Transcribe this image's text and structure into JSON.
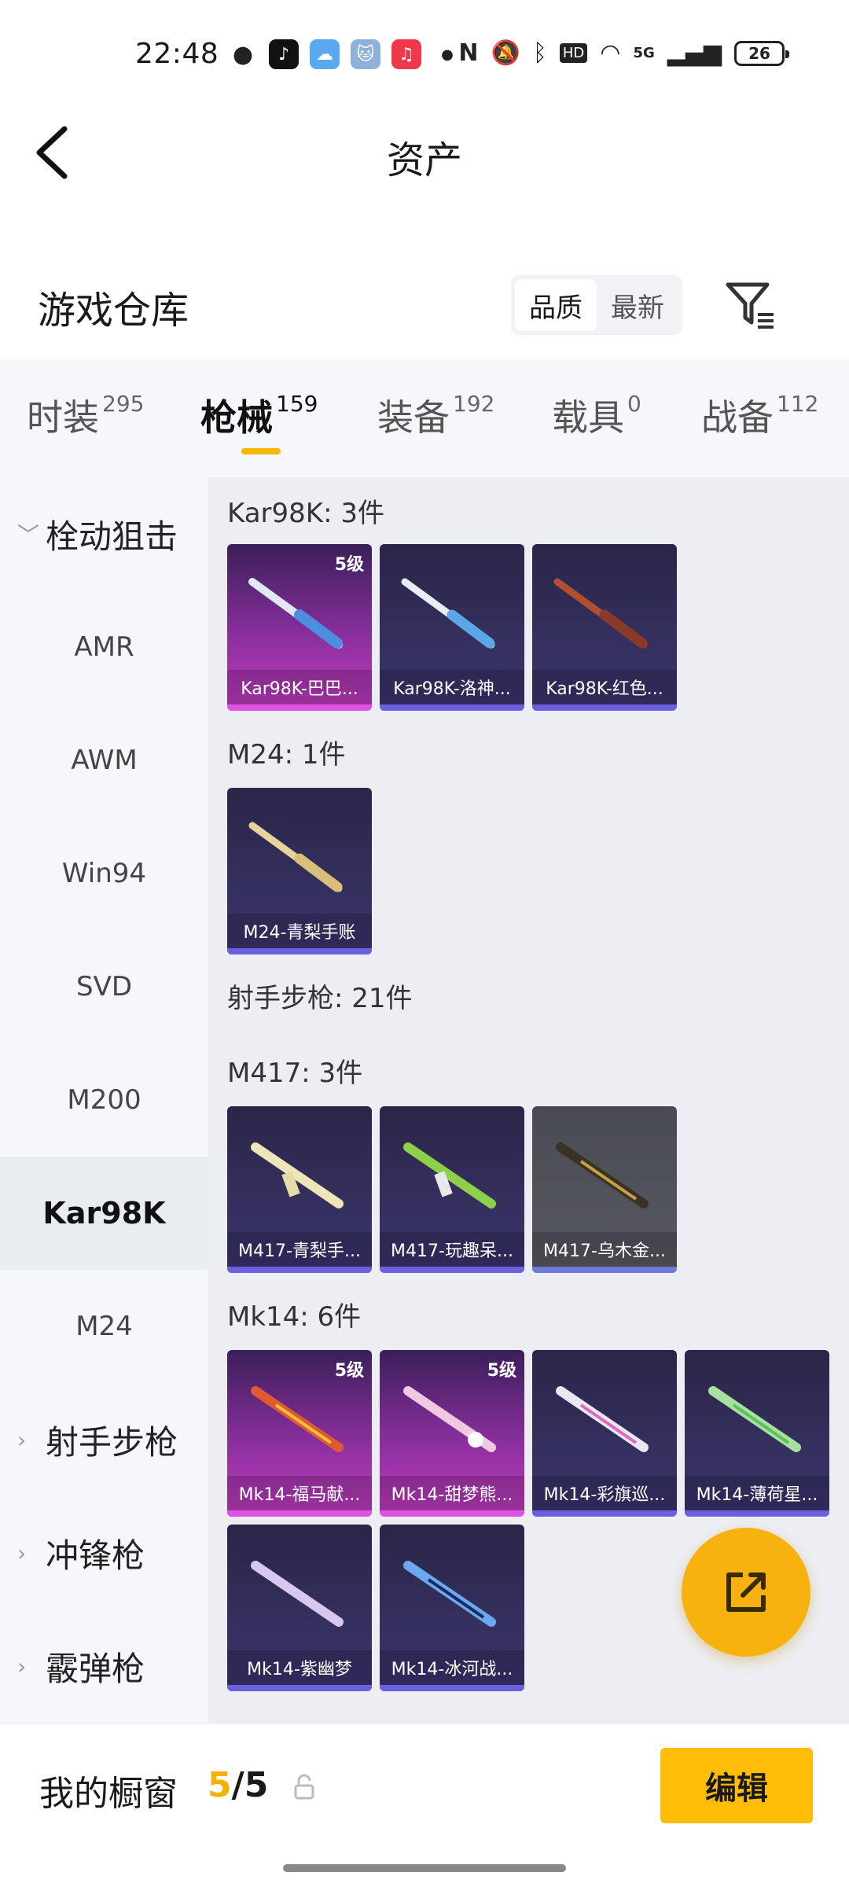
{
  "status_bar": {
    "time": "22:48",
    "network": "5G",
    "hd": "HD",
    "battery": "26"
  },
  "nav": {
    "title": "资产"
  },
  "warehouse": {
    "title": "游戏仓库",
    "sort_options": [
      "品质",
      "最新"
    ]
  },
  "tabs": [
    {
      "label": "时装",
      "count": "295"
    },
    {
      "label": "枪械",
      "count": "159"
    },
    {
      "label": "装备",
      "count": "192"
    },
    {
      "label": "载具",
      "count": "0"
    },
    {
      "label": "战备",
      "count": "112"
    }
  ],
  "side_menu": [
    {
      "label": "栓动狙击"
    },
    {
      "label": "AMR"
    },
    {
      "label": "AWM"
    },
    {
      "label": "Win94"
    },
    {
      "label": "SVD"
    },
    {
      "label": "M200"
    },
    {
      "label": "Kar98K"
    },
    {
      "label": "M24"
    },
    {
      "label": "射手步枪"
    },
    {
      "label": "冲锋枪"
    },
    {
      "label": "霰弹枪"
    }
  ],
  "sections": {
    "kar98k": {
      "title": "Kar98K: 3件"
    },
    "m24": {
      "title": "M24: 1件"
    },
    "marksman": {
      "title": "射手步枪: 21件"
    },
    "m417": {
      "title": "M417: 3件"
    },
    "mk14": {
      "title": "Mk14: 6件"
    }
  },
  "cards": [
    {
      "name": "Kar98K-巴巴...",
      "level": "5级"
    },
    {
      "name": "Kar98K-洛神..."
    },
    {
      "name": "Kar98K-红色..."
    },
    {
      "name": "M24-青梨手账"
    },
    {
      "name": "M417-青梨手..."
    },
    {
      "name": "M417-玩趣呆..."
    },
    {
      "name": "M417-乌木金..."
    },
    {
      "name": "Mk14-福马献...",
      "level": "5级"
    },
    {
      "name": "Mk14-甜梦熊...",
      "level": "5级"
    },
    {
      "name": "Mk14-彩旗巡..."
    },
    {
      "name": "Mk14-薄荷星..."
    },
    {
      "name": "Mk14-紫幽梦"
    },
    {
      "name": "Mk14-冰河战..."
    }
  ],
  "bottom": {
    "showcase_label": "我的橱窗",
    "showcase_used": "5",
    "showcase_total": "/5",
    "edit_label": "编辑"
  },
  "colors": {
    "accent": "#f5b800",
    "card_purple": "#35305e",
    "card_pink": "#c23dc0"
  }
}
